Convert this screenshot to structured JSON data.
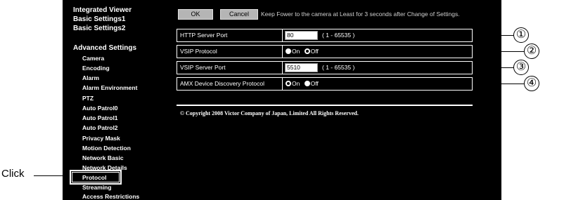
{
  "annotation": {
    "click_label": "Click"
  },
  "sidebar": {
    "top_items": [
      "Integrated Viewer",
      "Basic Settings1",
      "Basic Settings2"
    ],
    "section_title": "Advanced Settings",
    "sub_items": [
      "Camera",
      "Encoding",
      "Alarm",
      "Alarm Environment",
      "PTZ",
      "Auto Patrol0",
      "Auto Patrol1",
      "Auto Patrol2",
      "Privacy Mask",
      "Motion Detection",
      "Network Basic",
      "Network Details",
      "Protocol",
      "Streaming",
      "Access Restrictions"
    ],
    "selected": "Protocol"
  },
  "toolbar": {
    "ok_label": "OK",
    "cancel_label": "Cancel",
    "notice": "Keep Fower to the camera at Least for 3 seconds after Change of Settings."
  },
  "settings": {
    "http_port": {
      "label": "HTTP Server Port",
      "value": "80",
      "range": "( 1 - 65535 )"
    },
    "vsip_protocol": {
      "label": "VSIP Protocol",
      "on_label": "On",
      "off_label": "Off",
      "selected": "Off"
    },
    "vsip_port": {
      "label": "VSIP Server Port",
      "value": "5510",
      "range": "( 1 - 65535 )"
    },
    "amx": {
      "label": "AMX Device Discovery Protocol",
      "on_label": "On",
      "off_label": "Off",
      "selected": "On"
    }
  },
  "copyright": "© Copyright 2008 Victor Company of Japan, Limited All Rights Reserved.",
  "callouts": [
    "①",
    "②",
    "③",
    "④"
  ]
}
